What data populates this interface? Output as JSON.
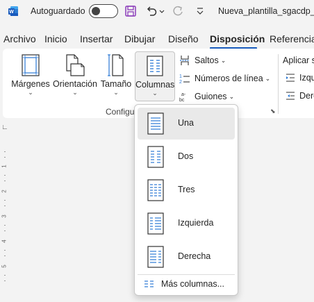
{
  "titlebar": {
    "autosave_label": "Autoguardado",
    "doc_title": "Nueva_plantilla_sgacdp_es"
  },
  "tabs": [
    {
      "label": "Archivo"
    },
    {
      "label": "Inicio"
    },
    {
      "label": "Insertar"
    },
    {
      "label": "Dibujar"
    },
    {
      "label": "Diseño"
    },
    {
      "label": "Disposición",
      "active": true
    },
    {
      "label": "Referencias"
    }
  ],
  "ribbon": {
    "margins_label": "Márgenes",
    "orientation_label": "Orientación",
    "size_label": "Tamaño",
    "columns_label": "Columnas",
    "breaks_label": "Saltos",
    "line_numbers_label": "Números de línea",
    "hyphenation_label": "Guiones",
    "group_label": "Configu",
    "apply_label": "Aplicar s",
    "left_label": "Izqu",
    "right_label": "Dere"
  },
  "columns_menu": {
    "items": [
      {
        "label": "Una"
      },
      {
        "label": "Dos"
      },
      {
        "label": "Tres"
      },
      {
        "label": "Izquierda"
      },
      {
        "label": "Derecha"
      }
    ],
    "more_label": "Más columnas..."
  },
  "ruler": {
    "numbers": [
      "1",
      "2",
      "3",
      "4",
      "5"
    ]
  },
  "colors": {
    "accent": "#185abd",
    "icon_blue": "#2b79d6",
    "save_purple": "#8a3ab9"
  }
}
